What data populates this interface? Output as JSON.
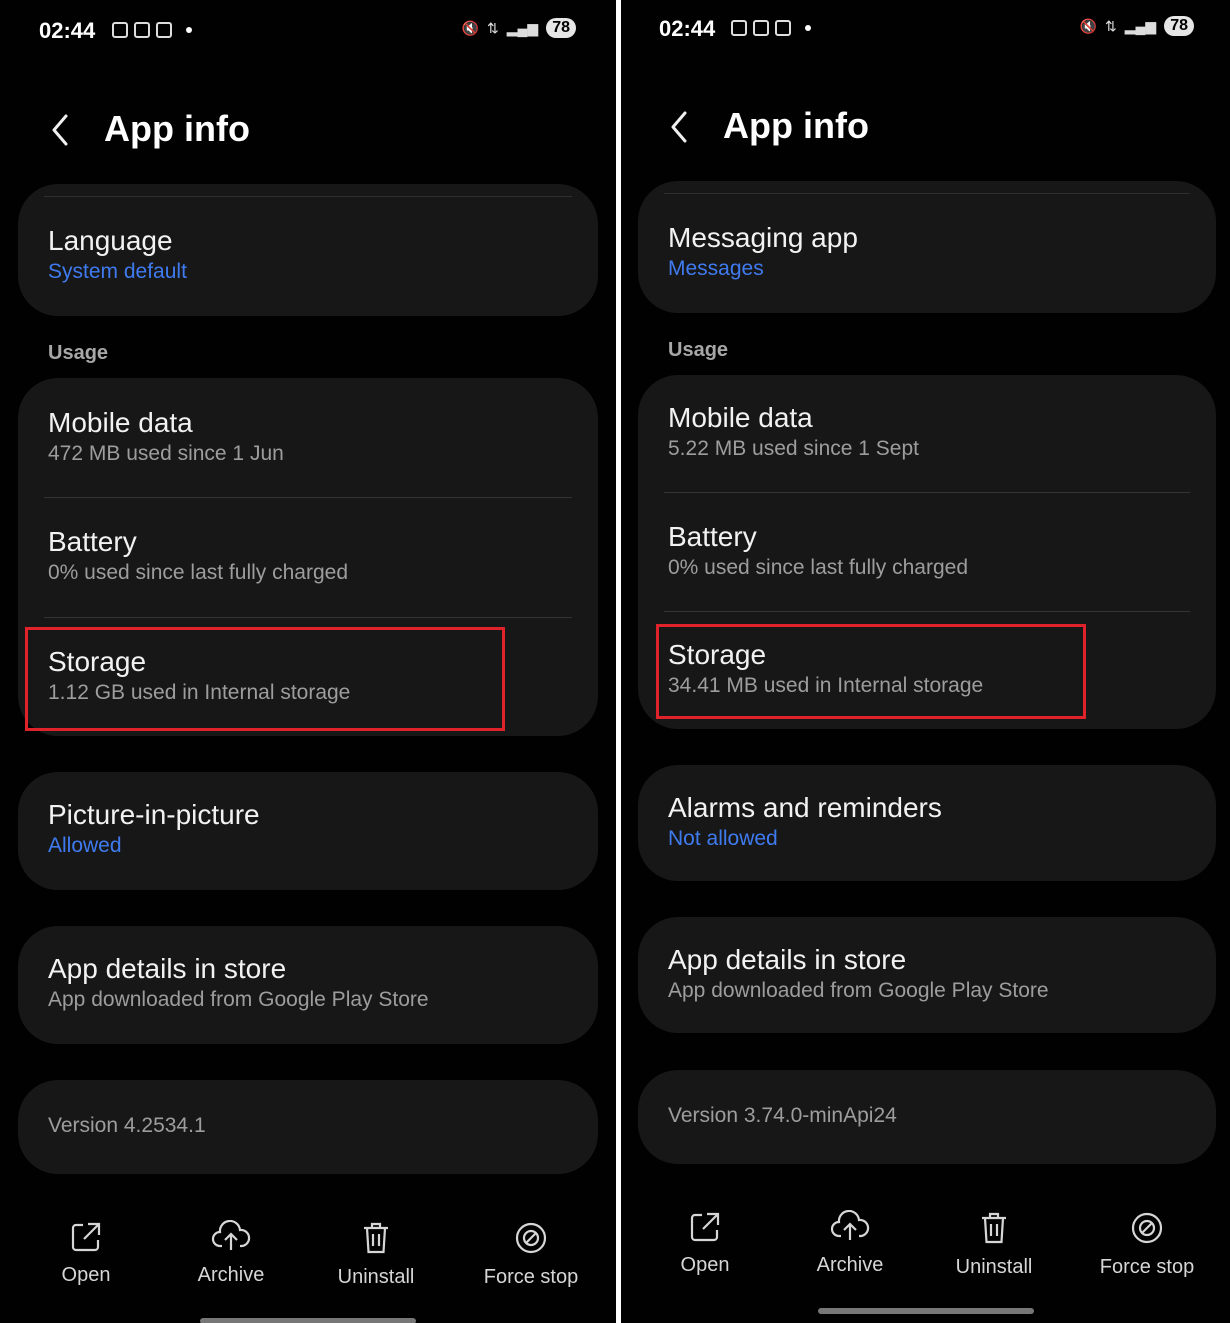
{
  "left": {
    "status": {
      "time": "02:44",
      "battery": "78"
    },
    "header": {
      "title": "App info"
    },
    "top_card": {
      "title": "Language",
      "subtitle": "System default"
    },
    "usage_section": "Usage",
    "usage": [
      {
        "title": "Mobile data",
        "subtitle": "472 MB used since 1 Jun"
      },
      {
        "title": "Battery",
        "subtitle": "0% used since last fully charged"
      },
      {
        "title": "Storage",
        "subtitle": "1.12 GB used in Internal storage"
      }
    ],
    "pip": {
      "title": "Picture-in-picture",
      "subtitle": "Allowed"
    },
    "store": {
      "title": "App details in store",
      "subtitle": "App downloaded from Google Play Store"
    },
    "version": "Version 4.2534.1",
    "actions": [
      {
        "label": "Open",
        "icon": "open-icon"
      },
      {
        "label": "Archive",
        "icon": "archive-icon"
      },
      {
        "label": "Uninstall",
        "icon": "trash-icon"
      },
      {
        "label": "Force stop",
        "icon": "force-stop-icon"
      }
    ]
  },
  "right": {
    "status": {
      "time": "02:44",
      "battery": "78"
    },
    "header": {
      "title": "App info"
    },
    "top_card": {
      "title": "Messaging app",
      "subtitle": "Messages"
    },
    "usage_section": "Usage",
    "usage": [
      {
        "title": "Mobile data",
        "subtitle": "5.22 MB used since 1 Sept"
      },
      {
        "title": "Battery",
        "subtitle": "0% used since last fully charged"
      },
      {
        "title": "Storage",
        "subtitle": "34.41 MB used in Internal storage"
      }
    ],
    "alarms": {
      "title": "Alarms and reminders",
      "subtitle": "Not allowed"
    },
    "store": {
      "title": "App details in store",
      "subtitle": "App downloaded from Google Play Store"
    },
    "version": "Version 3.74.0-minApi24",
    "actions": [
      {
        "label": "Open",
        "icon": "open-icon"
      },
      {
        "label": "Archive",
        "icon": "archive-icon"
      },
      {
        "label": "Uninstall",
        "icon": "trash-icon"
      },
      {
        "label": "Force stop",
        "icon": "force-stop-icon"
      }
    ]
  },
  "colors": {
    "accent_blue": "#3f7bef",
    "highlight_red": "#e0222b",
    "card_bg": "#171717"
  }
}
